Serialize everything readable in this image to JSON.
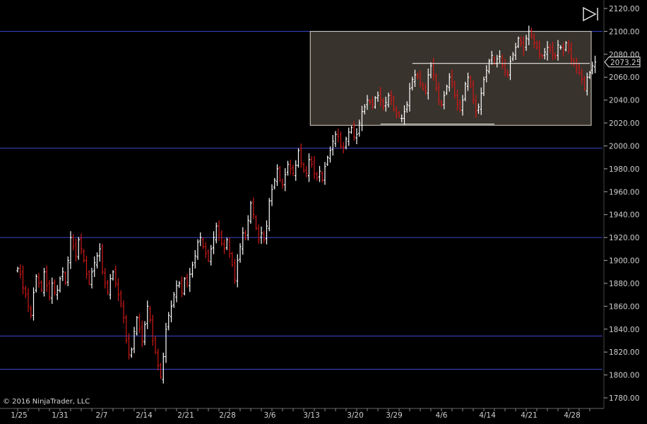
{
  "copyright": "© 2016 NinjaTrader, LLC",
  "last_price_label": "2073.25",
  "play_icon": "skip-to-end-icon",
  "colors": {
    "background": "#000000",
    "up_bar": "#ffffff",
    "down_bar": "#d01818",
    "level_line": "#3d47c8",
    "zone_fill": "#3b362e",
    "zone_border": "#d8d3c8",
    "axis_text": "#cfcfcf"
  },
  "chart_data": {
    "type": "ohlc",
    "ylim": [
      1775,
      2125
    ],
    "y_ticks": [
      2120,
      2100,
      2080,
      2060,
      2040,
      2020,
      2000,
      1980,
      1960,
      1940,
      1920,
      1900,
      1880,
      1860,
      1840,
      1820,
      1800,
      1780
    ],
    "y_tick_labels": [
      "2120.00",
      "2100.00",
      "2080.00",
      "2060.00",
      "2040.00",
      "2020.00",
      "2000.00",
      "1980.00",
      "1960.00",
      "1940.00",
      "1920.00",
      "1900.00",
      "1880.00",
      "1860.00",
      "1840.00",
      "1820.00",
      "1800.00",
      "1780.00"
    ],
    "x_tick_labels": [
      "1/25",
      "1/31",
      "2/7",
      "2/14",
      "2/21",
      "2/28",
      "3/6",
      "3/13",
      "3/20",
      "3/29",
      "4/6",
      "4/14",
      "4/21",
      "4/28"
    ],
    "horizontal_levels": [
      2100,
      1998,
      1920,
      1834,
      1805
    ],
    "zone": {
      "top": 2100,
      "bottom": 2018,
      "start_bar": 111,
      "end_bar": 216
    },
    "lines": [
      {
        "price": 2072,
        "start_bar": 149,
        "end_bar": 216,
        "color": "#ffffff"
      },
      {
        "price": 2019,
        "start_bar": 137,
        "end_bar": 180,
        "color": "#ffffff"
      }
    ],
    "last_price": 2073.25,
    "closes": [
      1893,
      1888,
      1876,
      1870,
      1860,
      1852,
      1872,
      1886,
      1880,
      1874,
      1890,
      1878,
      1868,
      1880,
      1872,
      1874,
      1884,
      1890,
      1880,
      1900,
      1920,
      1912,
      1904,
      1918,
      1910,
      1900,
      1888,
      1880,
      1890,
      1898,
      1904,
      1910,
      1890,
      1880,
      1872,
      1884,
      1890,
      1880,
      1870,
      1862,
      1850,
      1830,
      1818,
      1822,
      1838,
      1850,
      1840,
      1830,
      1844,
      1860,
      1848,
      1830,
      1820,
      1808,
      1798,
      1816,
      1840,
      1852,
      1860,
      1870,
      1878,
      1880,
      1872,
      1884,
      1880,
      1888,
      1896,
      1904,
      1916,
      1920,
      1912,
      1906,
      1900,
      1910,
      1920,
      1930,
      1922,
      1915,
      1910,
      1918,
      1906,
      1896,
      1883,
      1900,
      1912,
      1924,
      1920,
      1935,
      1950,
      1940,
      1928,
      1918,
      1924,
      1918,
      1930,
      1952,
      1962,
      1970,
      1980,
      1970,
      1966,
      1975,
      1984,
      1980,
      1976,
      1983,
      1996,
      1985,
      1978,
      1976,
      1988,
      1984,
      1976,
      1972,
      1978,
      1970,
      1982,
      1990,
      1996,
      2004,
      2010,
      2008,
      2000,
      1998,
      2006,
      2012,
      2016,
      2008,
      2010,
      2020,
      2030,
      2034,
      2040,
      2038,
      2036,
      2042,
      2044,
      2040,
      2034,
      2038,
      2044,
      2040,
      2032,
      2028,
      2026,
      2024,
      2030,
      2036,
      2050,
      2058,
      2062,
      2060,
      2055,
      2050,
      2048,
      2062,
      2070,
      2062,
      2050,
      2040,
      2036,
      2044,
      2052,
      2060,
      2056,
      2044,
      2036,
      2032,
      2040,
      2054,
      2060,
      2052,
      2040,
      2030,
      2034,
      2046,
      2058,
      2066,
      2074,
      2079,
      2072,
      2076,
      2078,
      2070,
      2066,
      2062,
      2074,
      2080,
      2086,
      2094,
      2090,
      2084,
      2094,
      2100,
      2096,
      2090,
      2086,
      2080,
      2078,
      2082,
      2086,
      2084,
      2080,
      2078,
      2088,
      2086,
      2082,
      2090,
      2084,
      2076,
      2072,
      2068,
      2064,
      2058,
      2050,
      2060,
      2064,
      2070,
      2073.25
    ]
  }
}
